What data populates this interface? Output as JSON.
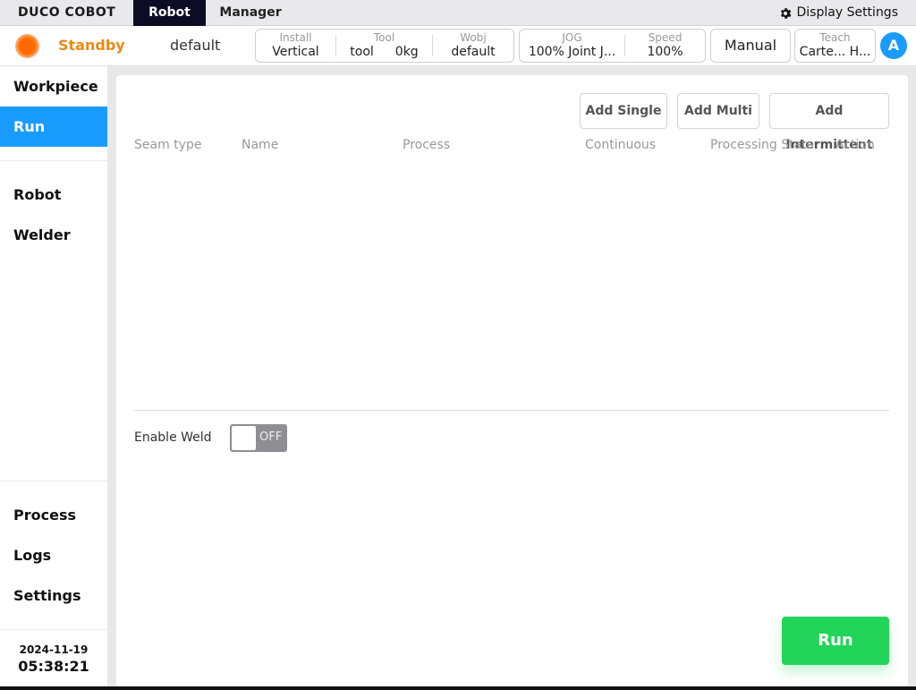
{
  "topbar": {
    "logo": "DUCO COBOT",
    "tabs": [
      "Robot",
      "Manager"
    ],
    "display_settings": "Display Settings"
  },
  "status": {
    "state": "Standby",
    "project": "default",
    "colors": {
      "state": "#e98a17",
      "indicator": "#ff6a00",
      "accent": "#1a9cff",
      "run": "#22d45a"
    },
    "install": {
      "caption": "Install",
      "value": "Vertical"
    },
    "tool": {
      "caption": "Tool",
      "name": "tool",
      "weight": "0kg"
    },
    "wobj": {
      "caption": "Wobj",
      "value": "default"
    },
    "jog": {
      "caption": "JOG",
      "value": "100% Joint J..."
    },
    "speed": {
      "caption": "Speed",
      "value": "100%"
    },
    "mode_button": "Manual",
    "teach": {
      "caption": "Teach",
      "value": "Carte... H..."
    },
    "avatar": "A"
  },
  "sidebar": {
    "items": [
      "Workpiece",
      "Run",
      "Robot",
      "Welder",
      "Process",
      "Logs",
      "Settings"
    ],
    "active": "Run",
    "date": "2024-11-19",
    "time": "05:38:21"
  },
  "main": {
    "buttons": {
      "add_single": "Add Single",
      "add_multi": "Add Multi",
      "add_intermittent": "Add Intermittent"
    },
    "columns": [
      "Seam type",
      "Name",
      "Process",
      "Continuous",
      "Processing State",
      "Action"
    ],
    "rows": [],
    "enable_weld_label": "Enable Weld",
    "enable_weld_state": "OFF",
    "run_button": "Run"
  }
}
